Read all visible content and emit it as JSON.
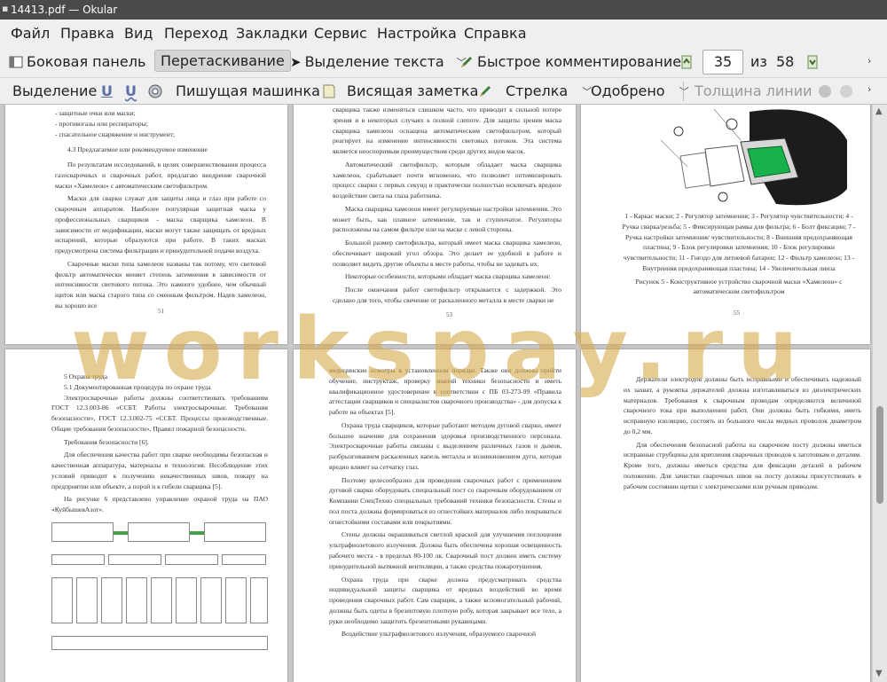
{
  "window": {
    "title": "14413.pdf — Okular"
  },
  "menu": [
    "Файл",
    "Правка",
    "Вид",
    "Переход",
    "Закладки",
    "Сервис",
    "Настройка",
    "Справка"
  ],
  "toolbar1": {
    "sidebar": "Боковая панель",
    "drag": "Перетаскивание",
    "text_select": "Выделение текста",
    "quick_annot": "Быстрое комментирование",
    "page_current": "35",
    "page_of": "из",
    "page_total": "58"
  },
  "toolbar2": {
    "highlight": "Выделение",
    "typewriter": "Пишущая машинка",
    "note": "Висящая заметка",
    "arrow": "Стрелка",
    "approved": "Одобрено",
    "line_width": "Толщина линии"
  },
  "watermark": "workspay.ru",
  "pages": {
    "p1": {
      "items": [
        "- защитные очки или маски;",
        "- противогазы или респираторы;",
        "- спасательное снаряжение и инструмент;"
      ],
      "heading": "4.3 Предлагаемое или рекомендуемое изменение",
      "paras": [
        "По результатам исследований, в целях совершенствования процесса газосварочных и сварочных работ, предлагаю внедрение сварочной маски «Хамелеон» с автоматическим светофильтром.",
        "Маски для сварки служат для защиты лица и глаз при работе со сварочным аппаратом. Наиболее популярная защитная маска у профессиональных сварщиков - маска сварщика хамелеон. В зависимости от модификации, маски могут также защищать от вредных испарений, которые образуются при работе. В таких масках предусмотрена система фильтрации и принудительной подачи воздуха.",
        "Сварочные маски типа хамелеон названы так потому, что световой фильтр автоматически меняет степень затемнения в зависимости от интенсивности светового потока. Это намного удобнее, чем обычный щиток или маска старого типа со сменным фильтром. Надев хамелеон, вы хорошо все"
      ],
      "num": "51"
    },
    "p2": {
      "paras": [
        "сварщика также изменяться слишком часто, что приводит к сильной потере зрения и в некоторых случаях к полной слепоте. Для защиты зрения маска сварщика хамелеон оснащена автоматическим светофильтром, который реагирует на изменение интенсивности световых потоков. Эта система является неоспоримым преимуществом среди других видов масок.",
        "Автоматический светофильтр, которым обладает маска сварщика хамелеон, срабатывает почти мгновенно, что позволяет оптимизировать процесс сварки с первых секунд и практически полностью исключать вредное воздействие света на глаза работника.",
        "Маска сварщика хамелеон имеет регулируемые настройки затемнения. Это может быть, как плавное затемнение, так и ступенчатое. Регуляторы расположены на самом фильтре или на маске с левой стороны.",
        "Большой размер светофильтра, который имеет маска сварщика хамелеон, обеспечивает широкий угол обзора. Это делает ее удобной в работе и позволяет видеть другие объекты в месте работы, чтобы не задевать их.",
        "Некоторые особенности, которыми обладает маска сварщика хамелеон:",
        "После окончания работ светофильтр открывается с задержкой. Это сделано для того, чтобы свечение от раскаленного металла в месте сварки не"
      ],
      "num": "53"
    },
    "p3": {
      "legend": "1 - Каркас маски; 2 - Регулятор затемнения; 3 - Регулятор чувствительности; 4 - Ручка сварка/резьба; 5 - Фиксирующая рамка для фильтра; 6 - Болт фиксации; 7 - Ручка настройки затемнения/ чувствительности; 8 - Внешняя предохраняющая пластина; 9 - Блок регулировки затемнения; 10 - Блок регулировки чувствительности; 11 - Гнездо для литиевой батареи; 12 - Фильтр хамелеон; 13 - Внутренняя предохраняющая пластина; 14 - Увеличительная линза",
      "caption": "Рисунок 5 - Конструктивное устройство сварочной маски «Хамелеон» с автоматическим светофильтром",
      "num": "55"
    },
    "p4": {
      "h1": "5 Охрана труда",
      "h2": "5.1 Документированная процедура по охране труда",
      "paras": [
        "Электросварочные работы должны соответствовать требованиям ГОСТ 12.3.003-86 «ССБТ. Работы электросварочные. Требования безопасности», ГОСТ 12.3.002-75 «ССБТ. Процессы производственные. Общие требования безопасности», Правил пожарной безопасности.",
        "Требования безопасности [6].",
        "Для обеспечения качества работ при сварке необходимы безопасная и качественная аппаратура, материалы и технология. Несоблюдение этих условий приводит к получению некачественных швов, пожару на предприятии или объекте, а порой и к гибели сварщика [5].",
        "На рисунке 6 представлено управление охраной труда на ПАО «КуйбышевАзот»."
      ]
    },
    "p5": {
      "paras": [
        "медицинские осмотры в установленном порядке. Также они должны пройти обучение, инструктаж, проверку знаний техники безопасности и иметь квалификационное удостоверение в соответствии с ПБ 03-273-99 «Правила аттестации сварщиков и специалистов сварочного производства» - для допуска к работе на объектах [5].",
        "Охрана труда сварщиков, которые работают методом дуговой сварки, имеет большое значение для сохранения здоровья производственного персонала. Электросварочные работы связаны с выделением различных газов и дымов, разбрызгиванием раскаленных капель металла и возникновением дуги, которая вредно влияет на сетчатку глаз.",
        "Поэтому целесообразно для проведения сварочных работ с применением дуговой сварки оборудовать специальный пост со сварочным оборудованием от Компании СпецТехно специальных требований техники безопасности. Стены и пол поста должны формироваться из огнестойких материалов либо покрываться огнестойкими составами или покрытиями.",
        "Стены должны окрашиваться светлой краской для улучшения поглощения ультрафиолетового излучения. Должна быть обеспечена хорошая освещенность рабочего места - в пределах 80-100 лк. Сварочный пост должен иметь систему принудительной вытяжной вентиляции, а также средства пожаротушения.",
        "Охрана труда при сварке должна предусматривать средства индивидуальной защиты сварщика от вредных воздействий во время проведения сварочных работ. Сам сварщик, а также вспомогательный рабочий, должны быть одеты в брезентовую плотную робу, которая закрывает все тело, а руки необходимо защитить брезентовыми рукавицами.",
        "Воздействие ультрафиолетового излучения, образуемого сварочной"
      ]
    },
    "p6": {
      "paras": [
        "Держатели электродов должны быть исправными и обеспечивать надежный их захват, а рукоятка держателей должна изготавливаться из диэлектрических материалов. Требования к сварочным проводам определяются величиной сварочного тока при выполнении работ. Они должны быть гибкими, иметь исправную изоляцию, состоять из большого числа медных проволок диаметром до 0,2 мм.",
        "Для обеспечения безопасной работы на сварочном посту должны иметься исправные струбцины для крепления сварочных проводов к заготовкам и деталям. Кроме того, должны иметься средства для фиксации деталей в рабочем положении. Для зачистки сварочных швов на посту должны присутствовать в рабочем состоянии щетки с электрическими или ручным приводом."
      ]
    }
  }
}
